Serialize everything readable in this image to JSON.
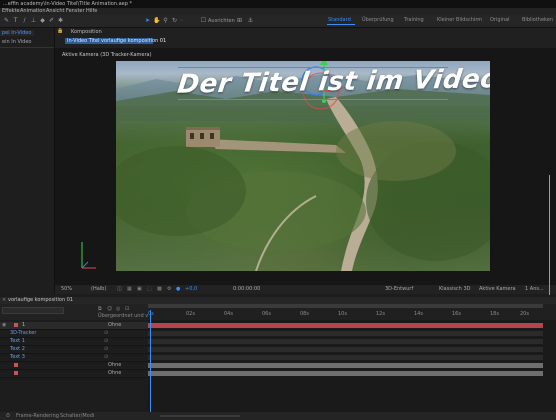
{
  "window": {
    "title": "...effin academy\\In-Video Titel\\Title Animation.aep *"
  },
  "menu": [
    "Effekte",
    "Animation",
    "Ansicht",
    "Fenster",
    "Hilfe"
  ],
  "toolbar": {
    "snap_label": "Ausrichten"
  },
  "workspaces": {
    "tabs": [
      "Standard",
      "Überprüfung",
      "Training",
      "Kleiner Bildschirm",
      "Original",
      "Bibliotheken"
    ],
    "active_index": 0
  },
  "left_panel": {
    "tab": "рei In-Video",
    "subtab": "ein In Video"
  },
  "composition": {
    "panel_label": "Komposition",
    "tab_label": "In-Video Titel vorlaufige komposition 01",
    "camera_label": "Aktive Kamera (3D Tracker-Kamera)"
  },
  "video_title": "Der Titel ist im Video",
  "viewer_bar": {
    "zoom": "50%",
    "resolution": "(Halb)",
    "timecode": "0:00:00:00",
    "renderer": "3D-Entwurf",
    "renderer_mode": "Klassisch 3D",
    "camera_select": "Aktive Kamera",
    "views": "1 Ans..."
  },
  "timeline": {
    "tab_label": "vorlaufige komposition 01",
    "parent_header": "Übergeordnet und verk...",
    "ruler_ticks": [
      "02s",
      "04s",
      "06s",
      "08s",
      "10s",
      "12s",
      "14s",
      "16s",
      "18s",
      "20s",
      "22s"
    ],
    "layers": [
      {
        "num": "1",
        "name": "",
        "parent": "Ohne",
        "color": "#c9535a"
      },
      {
        "num": "",
        "name": "3D-Tracker",
        "parent": "",
        "color": "#6aa0d8"
      },
      {
        "num": "",
        "name": "Text 1",
        "parent": "",
        "color": "#6aa0d8"
      },
      {
        "num": "",
        "name": "Text 2",
        "parent": "",
        "color": "#6aa0d8"
      },
      {
        "num": "",
        "name": "Text 3",
        "parent": "",
        "color": "#6aa0d8"
      },
      {
        "num": "",
        "name": "",
        "parent": "Ohne",
        "color": "#c9535a"
      },
      {
        "num": "",
        "name": "",
        "parent": "Ohne",
        "color": "#c9535a"
      }
    ]
  },
  "bottom_bar": {
    "fps_label": "Frame-Rendering",
    "switches_label": "Schalter/Modi"
  },
  "colors": {
    "accent": "#3d8ef7",
    "selection": "#d05a8a",
    "track_red": "#b5454d",
    "track_gray": "#6f6f6f"
  }
}
